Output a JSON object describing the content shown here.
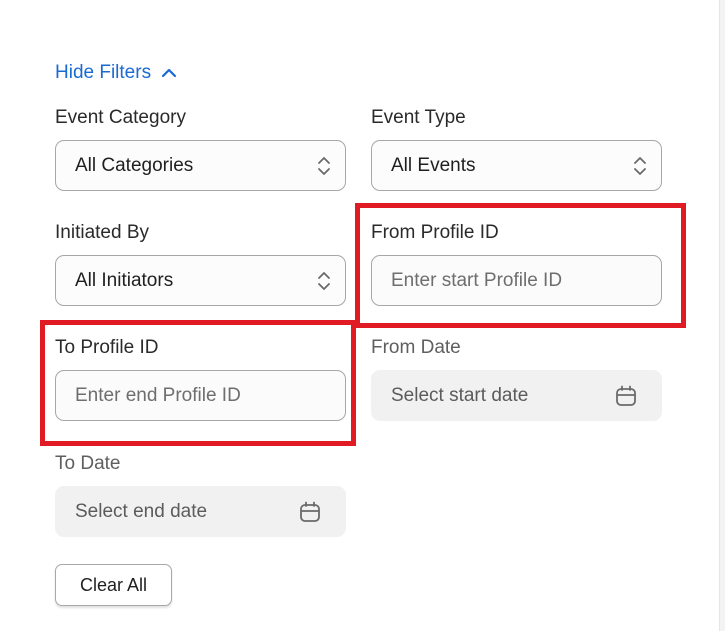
{
  "filters": {
    "toggle_label": "Hide Filters",
    "event_category": {
      "label": "Event Category",
      "value": "All Categories"
    },
    "event_type": {
      "label": "Event Type",
      "value": "All Events"
    },
    "initiated_by": {
      "label": "Initiated By",
      "value": "All Initiators"
    },
    "from_profile_id": {
      "label": "From Profile ID",
      "placeholder": "Enter start Profile ID"
    },
    "to_profile_id": {
      "label": "To Profile ID",
      "placeholder": "Enter end Profile ID"
    },
    "from_date": {
      "label": "From Date",
      "placeholder": "Select start date"
    },
    "to_date": {
      "label": "To Date",
      "placeholder": "Select end date"
    },
    "clear_label": "Clear All"
  },
  "colors": {
    "link": "#1a6ad4",
    "highlight": "#e01b23",
    "disabled_bg": "#f1f1f1"
  },
  "icons": {
    "toggle": "chevron-up-icon",
    "select": "up-down-chevron-icon",
    "date": "calendar-icon"
  }
}
